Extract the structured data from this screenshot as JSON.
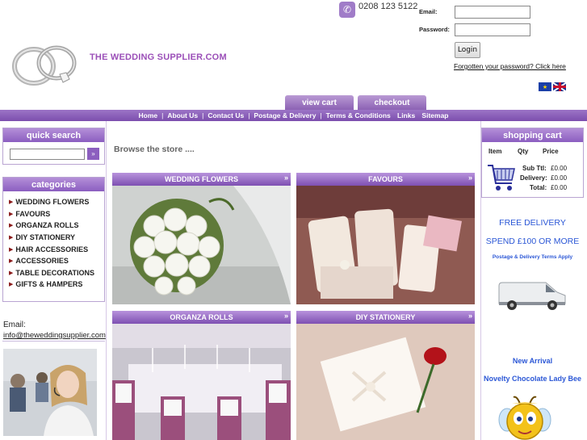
{
  "header": {
    "site_title": "THE WEDDING SUPPLIER.COM",
    "phone": "0208 123 5122",
    "phone_icon": "phone-icon"
  },
  "login": {
    "email_label": "Email:",
    "password_label": "Password:",
    "email_value": "",
    "password_value": "",
    "login_button": "Login",
    "forgot_link": "Forgotten your password? Click here"
  },
  "tabs": {
    "view_cart": "view cart",
    "checkout": "checkout"
  },
  "nav": {
    "links": [
      "Home",
      "About Us",
      "Contact Us",
      "Postage & Delivery",
      "Terms & Conditions",
      "Links",
      "Sitemap"
    ]
  },
  "quick_search": {
    "title": "quick search",
    "value": "",
    "go_icon": "double-chevron-right-icon"
  },
  "categories": {
    "title": "categories",
    "items": [
      "WEDDING FLOWERS",
      "FAVOURS",
      "ORGANZA ROLLS",
      "DIY STATIONERY",
      "HAIR ACCESSORIES",
      "ACCESSORIES",
      "TABLE DECORATIONS",
      "GIFTS & HAMPERS"
    ]
  },
  "contact": {
    "email_label": "Email:",
    "email": "info@theweddingsupplier.com"
  },
  "main": {
    "browse_title": "Browse the store ....",
    "tiles": [
      "WEDDING FLOWERS",
      "FAVOURS",
      "ORGANZA ROLLS",
      "DIY STATIONERY"
    ],
    "tile_chevron": "»"
  },
  "cart": {
    "title": "shopping cart",
    "col_item": "Item",
    "col_qty": "Qty",
    "col_price": "Price",
    "sub_total_label": "Sub Ttl:",
    "sub_total": "£0.00",
    "delivery_label": "Delivery:",
    "delivery": "£0.00",
    "total_label": "Total:",
    "total": "£0.00"
  },
  "promo": {
    "free_delivery": "FREE DELIVERY",
    "spend_over": "SPEND £100 OR MORE",
    "terms_link": "Postage & Delivery Terms Apply",
    "new_arrival": "New Arrival",
    "product": "Novelty Chocolate Lady Bee"
  },
  "colors": {
    "brand_purple": "#8c5fbf",
    "title_purple": "#9b4fb8",
    "promo_blue": "#2b57d6"
  }
}
